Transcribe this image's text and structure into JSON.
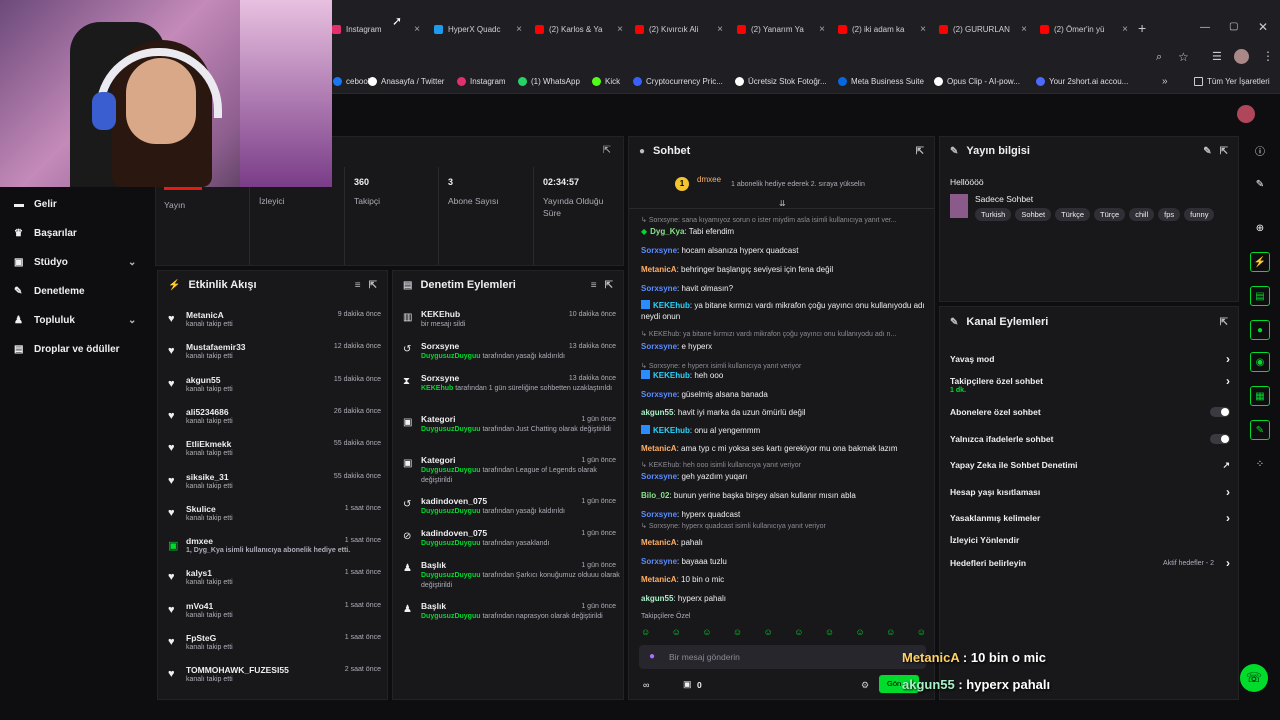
{
  "browser": {
    "tabs": [
      {
        "label": "Instagram",
        "color": "#e1306c"
      },
      {
        "label": "HyperX Quadc",
        "color": "#1d9bf0"
      },
      {
        "label": "(2) Karlos & Ya",
        "color": "#ff0000"
      },
      {
        "label": "(2) Kıvırcık Ali",
        "color": "#ff0000"
      },
      {
        "label": "(2) Yanarım Ya",
        "color": "#ff0000"
      },
      {
        "label": "(2) iki adam ka",
        "color": "#ff0000"
      },
      {
        "label": "(2) GURURLAN",
        "color": "#ff0000"
      },
      {
        "label": "(2) Ömer'in yü",
        "color": "#ff0000"
      }
    ],
    "bookmarks": [
      {
        "label": "cebook",
        "color": "#1877f2"
      },
      {
        "label": "Anasayfa / Twitter",
        "color": "#ffffff"
      },
      {
        "label": "Instagram",
        "color": "#e1306c"
      },
      {
        "label": "(1) WhatsApp",
        "color": "#25d366"
      },
      {
        "label": "Kick",
        "color": "#53fc18"
      },
      {
        "label": "Cryptocurrency Pric...",
        "color": "#3861fb"
      },
      {
        "label": "Ücretsiz Stok Fotoğr...",
        "color": "#ffffff"
      },
      {
        "label": "Meta Business Suite",
        "color": "#0668e1"
      },
      {
        "label": "Opus Clip - AI-pow...",
        "color": "#ffffff"
      },
      {
        "label": "Your 2short.ai accou...",
        "color": "#4b6bff"
      }
    ],
    "all_bookmarks": "Tüm Yer İşaretleri"
  },
  "sidebar": {
    "items": [
      {
        "label": "Gelir",
        "icon": "dollar-icon"
      },
      {
        "label": "Başarılar",
        "icon": "trophy-icon"
      },
      {
        "label": "Stüdyo",
        "icon": "studio-icon"
      },
      {
        "label": "Denetleme",
        "icon": "wrench-icon"
      },
      {
        "label": "Topluluk",
        "icon": "community-icon"
      },
      {
        "label": "Droplar ve ödüller",
        "icon": "gift-icon"
      }
    ]
  },
  "stats": {
    "items": [
      {
        "value": "",
        "label": "Yayın"
      },
      {
        "value": "",
        "label": "İzleyici"
      },
      {
        "value": "360",
        "label": "Takipçi"
      },
      {
        "value": "3",
        "label": "Abone Sayısı"
      },
      {
        "value": "02:34:57",
        "label": "Yayında Olduğu Süre"
      }
    ]
  },
  "activity": {
    "title": "Etkinlik Akışı",
    "rows": [
      {
        "name": "MetanicA",
        "sub": "kanalı takip etti",
        "time": "9 dakika önce"
      },
      {
        "name": "Mustafaemir33",
        "sub": "kanalı takip etti",
        "time": "12 dakika önce"
      },
      {
        "name": "akgun55",
        "sub": "kanalı takip etti",
        "time": "15 dakika önce"
      },
      {
        "name": "ali5234686",
        "sub": "kanalı takip etti",
        "time": "26 dakika önce"
      },
      {
        "name": "EtliEkmekk",
        "sub": "kanalı takip etti",
        "time": "55 dakika önce"
      },
      {
        "name": "siksike_31",
        "sub": "kanalı takip etti",
        "time": "55 dakika önce"
      },
      {
        "name": "Skulice",
        "sub": "kanalı takip etti",
        "time": "1 saat önce"
      },
      {
        "name": "dmxee",
        "sub": "1, Dyg_Kya isimli kullanıcıya abonelik hediye etti.",
        "time": "1 saat önce"
      },
      {
        "name": "kalys1",
        "sub": "kanalı takip etti",
        "time": "1 saat önce"
      },
      {
        "name": "mVo41",
        "sub": "kanalı takip etti",
        "time": "1 saat önce"
      },
      {
        "name": "FpSteG",
        "sub": "kanalı takip etti",
        "time": "1 saat önce"
      },
      {
        "name": "TOMMOHAWK_FUZESI55",
        "sub": "kanalı takip etti",
        "time": "2 saat önce"
      }
    ]
  },
  "moderation": {
    "title": "Denetim Eylemleri",
    "rows": [
      {
        "icon": "trash-icon",
        "name": "KEKEhub",
        "pre": "",
        "hl": "",
        "sub": "bir mesajı sildi",
        "time": "10 dakika önce"
      },
      {
        "icon": "undo-icon",
        "name": "Sorxsyne",
        "pre": "",
        "hl": "DuygusuzDuyguu",
        "sub": " tarafından yasağı kaldırıldı",
        "time": "13 dakika önce"
      },
      {
        "icon": "hourglass-icon",
        "name": "Sorxsyne",
        "pre": "",
        "hl": "KEKEhub",
        "sub": " tarafından 1 gün süreliğine sohbetten uzaklaştırıldı",
        "time": "13 dakika önce"
      },
      {
        "icon": "category-icon",
        "name": "Kategori",
        "pre": "",
        "hl": "DuygusuzDuyguu",
        "sub": " tarafından Just Chatting olarak değiştirildi",
        "time": "1 gün önce"
      },
      {
        "icon": "category-icon",
        "name": "Kategori",
        "pre": "",
        "hl": "DuygusuzDuyguu",
        "sub": " tarafından League of Legends olarak değiştirildi",
        "time": "1 gün önce"
      },
      {
        "icon": "undo-icon",
        "name": "kadindoven_075",
        "pre": "",
        "hl": "DuygusuzDuyguu",
        "sub": " tarafından yasağı kaldırıldı",
        "time": "1 gün önce"
      },
      {
        "icon": "ban-icon",
        "name": "kadindoven_075",
        "pre": "",
        "hl": "DuygusuzDuyguu",
        "sub": " tarafından yasaklandı",
        "time": "1 gün önce"
      },
      {
        "icon": "title-icon",
        "name": "Başlık",
        "pre": "",
        "hl": "DuygusuzDuyguu",
        "sub": " tarafından Şarkıcı konuğumuz olduuu olarak değiştirildi",
        "time": "1 gün önce"
      },
      {
        "icon": "title-icon",
        "name": "Başlık",
        "pre": "",
        "hl": "DuygusuzDuyguu",
        "sub": " tarafından naprasyon olarak değiştirildi",
        "time": "1 gün önce"
      }
    ]
  },
  "chat": {
    "title": "Sohbet",
    "pinned_user": "dmxee",
    "pinned_text": "1 abonelik hediye ederek 2. sıraya yükselin",
    "lines": [
      {
        "type": "reply",
        "text": "Sorxsyne: sana kıyamıyoz sorun o ister miydim asla isimli kullanıcıya yanıt ver..."
      },
      {
        "type": "msg",
        "user": "Dyg_Kya",
        "color": "#8be38b",
        "text": "Tabi efendim"
      },
      {
        "type": "msg",
        "user": "Sorxsyne",
        "color": "#5b8cff",
        "text": "hocam alsanıza hyperx quadcast"
      },
      {
        "type": "msg",
        "user": "MetanicA",
        "color": "#ffb066",
        "text": "behringer başlangıç seviyesi için fena değil"
      },
      {
        "type": "msg",
        "user": "Sorxsyne",
        "color": "#5b8cff",
        "text": "havit olmasın?"
      },
      {
        "type": "msg",
        "user": "KEKEhub",
        "color": "#2bd3ff",
        "text": "ya bitane kırmızı vardı mikrafon çoğu yayıncı onu kullanıyodu adı neydi onun"
      },
      {
        "type": "reply",
        "text": "KEKEhub: ya bitane kırmızı vardı mikrafon çoğu yayıncı onu kullanıyodu adı n..."
      },
      {
        "type": "msg",
        "user": "Sorxsyne",
        "color": "#5b8cff",
        "text": "e hyperx"
      },
      {
        "type": "reply",
        "text": "Sorxsyne: e hyperx isimli kullanıcıya yanıt veriyor"
      },
      {
        "type": "msg",
        "user": "KEKEhub",
        "color": "#2bd3ff",
        "text": "heh ooo"
      },
      {
        "type": "msg",
        "user": "Sorxsyne",
        "color": "#5b8cff",
        "text": "güselmiş alsana banada"
      },
      {
        "type": "msg",
        "user": "akgun55",
        "color": "#a8f0c6",
        "text": "havit iyi marka da uzun ömürlü değil"
      },
      {
        "type": "msg",
        "user": "KEKEhub",
        "color": "#2bd3ff",
        "text": "onu al yengemmm"
      },
      {
        "type": "msg",
        "user": "MetanicA",
        "color": "#ffb066",
        "text": "ama typ c mi yoksa ses kartı gerekiyor mu ona bakmak lazım"
      },
      {
        "type": "reply",
        "text": "KEKEhub: heh ooo isimli kullanıcıya yanıt veriyor"
      },
      {
        "type": "msg",
        "user": "Sorxsyne",
        "color": "#5b8cff",
        "text": "geh yazdım yuqarı"
      },
      {
        "type": "msg",
        "user": "Bilo_02",
        "color": "#8be38b",
        "text": "bunun yerine başka birşey alsan kullanır mısın abla"
      },
      {
        "type": "msg",
        "user": "Sorxsyne",
        "color": "#5b8cff",
        "text": "hyperx quadcast"
      },
      {
        "type": "reply",
        "text": "Sorxsyne: hyperx quadcast isimli kullanıcıya yanıt veriyor"
      },
      {
        "type": "msg",
        "user": "MetanicA",
        "color": "#ffb066",
        "text": "pahalı"
      },
      {
        "type": "msg",
        "user": "Sorxsyne",
        "color": "#5b8cff",
        "text": "bayaaa tuzlu"
      },
      {
        "type": "msg",
        "user": "MetanicA",
        "color": "#ffb066",
        "text": "10 bin o mic"
      },
      {
        "type": "msg",
        "user": "akgun55",
        "color": "#a8f0c6",
        "text": "hyperx pahalı"
      }
    ],
    "followers_only": "Takipçilere Özel",
    "input_placeholder": "Bir mesaj gönderin",
    "points": "0",
    "send_label": "Gön"
  },
  "stream_info": {
    "title": "Yayın bilgisi",
    "stream_title": "Hellöööö",
    "category": "Sadece Sohbet",
    "tags": [
      "Turkish",
      "Sohbet",
      "Türkçe",
      "Türçe",
      "chill",
      "fps",
      "funny"
    ]
  },
  "channel_actions": {
    "title": "Kanal Eylemleri",
    "rows": [
      {
        "label": "Yavaş mod",
        "extra": "",
        "control": "chevron"
      },
      {
        "label": "Takipçilere özel sohbet",
        "extra": "1 dk.",
        "control": "chevron"
      },
      {
        "label": "Abonelere özel sohbet",
        "extra": "",
        "control": "toggle"
      },
      {
        "label": "Yalnızca ifadelerle sohbet",
        "extra": "",
        "control": "toggle"
      },
      {
        "label": "Yapay Zeka ile Sohbet Denetimi",
        "extra": "",
        "control": "external"
      },
      {
        "label": "Hesap yaşı kısıtlaması",
        "extra": "",
        "control": "chevron"
      },
      {
        "label": "Yasaklanmış kelimeler",
        "extra": "",
        "control": "chevron"
      },
      {
        "label": "İzleyici Yönlendir",
        "extra": "",
        "control": "none"
      },
      {
        "label": "Hedefleri belirleyin",
        "extra": "Aktif hedefler - 2",
        "control": "chevron"
      }
    ]
  },
  "overlay": {
    "line1_user": "MetanicA",
    "line1_text": " : 10 bin o mic",
    "line2_user": "akgun55",
    "line2_text": " : hyperx pahalı"
  },
  "colors": {
    "accent": "#00db2c",
    "bg": "#0e0e10",
    "panel": "#18181b"
  }
}
